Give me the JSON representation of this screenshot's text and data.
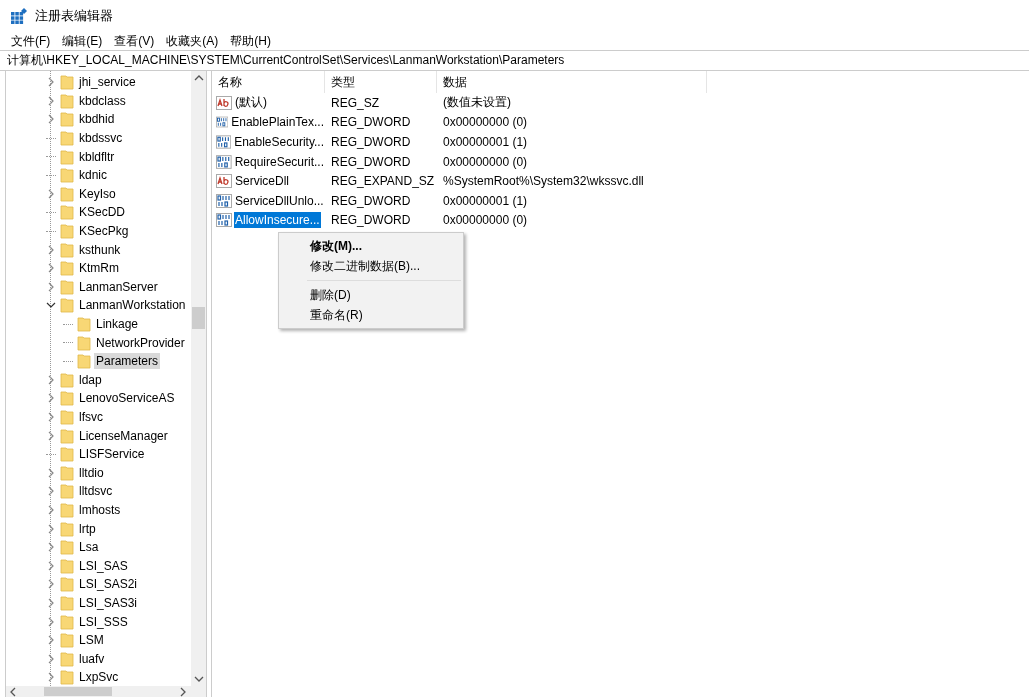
{
  "window": {
    "title": "注册表编辑器"
  },
  "menu": [
    {
      "label": "文件(F)"
    },
    {
      "label": "编辑(E)"
    },
    {
      "label": "查看(V)"
    },
    {
      "label": "收藏夹(A)"
    },
    {
      "label": "帮助(H)"
    }
  ],
  "address": "计算机\\HKEY_LOCAL_MACHINE\\SYSTEM\\CurrentControlSet\\Services\\LanmanWorkstation\\Parameters",
  "tree": [
    {
      "label": "jhi_service",
      "expandable": true,
      "expanded": false,
      "selected": false
    },
    {
      "label": "kbdclass",
      "expandable": true,
      "expanded": false,
      "selected": false
    },
    {
      "label": "kbdhid",
      "expandable": true,
      "expanded": false,
      "selected": false
    },
    {
      "label": "kbdssvc",
      "expandable": false,
      "selected": false
    },
    {
      "label": "kbldfltr",
      "expandable": false,
      "selected": false
    },
    {
      "label": "kdnic",
      "expandable": false,
      "selected": false
    },
    {
      "label": "KeyIso",
      "expandable": true,
      "expanded": false,
      "selected": false
    },
    {
      "label": "KSecDD",
      "expandable": false,
      "selected": false
    },
    {
      "label": "KSecPkg",
      "expandable": false,
      "selected": false
    },
    {
      "label": "ksthunk",
      "expandable": true,
      "expanded": false,
      "selected": false
    },
    {
      "label": "KtmRm",
      "expandable": true,
      "expanded": false,
      "selected": false
    },
    {
      "label": "LanmanServer",
      "expandable": true,
      "expanded": false,
      "selected": false
    },
    {
      "label": "LanmanWorkstation",
      "expandable": true,
      "expanded": true,
      "selected": false,
      "children": [
        {
          "label": "Linkage",
          "expandable": false,
          "selected": false
        },
        {
          "label": "NetworkProvider",
          "expandable": false,
          "selected": false
        },
        {
          "label": "Parameters",
          "expandable": false,
          "selected": true
        }
      ]
    },
    {
      "label": "ldap",
      "expandable": true,
      "expanded": false,
      "selected": false
    },
    {
      "label": "LenovoServiceAS",
      "expandable": true,
      "expanded": false,
      "selected": false
    },
    {
      "label": "lfsvc",
      "expandable": true,
      "expanded": false,
      "selected": false
    },
    {
      "label": "LicenseManager",
      "expandable": true,
      "expanded": false,
      "selected": false
    },
    {
      "label": "LISFService",
      "expandable": false,
      "selected": false
    },
    {
      "label": "lltdio",
      "expandable": true,
      "expanded": false,
      "selected": false
    },
    {
      "label": "lltdsvc",
      "expandable": true,
      "expanded": false,
      "selected": false
    },
    {
      "label": "lmhosts",
      "expandable": true,
      "expanded": false,
      "selected": false
    },
    {
      "label": "lrtp",
      "expandable": true,
      "expanded": false,
      "selected": false
    },
    {
      "label": "Lsa",
      "expandable": true,
      "expanded": false,
      "selected": false
    },
    {
      "label": "LSI_SAS",
      "expandable": true,
      "expanded": false,
      "selected": false
    },
    {
      "label": "LSI_SAS2i",
      "expandable": true,
      "expanded": false,
      "selected": false
    },
    {
      "label": "LSI_SAS3i",
      "expandable": true,
      "expanded": false,
      "selected": false
    },
    {
      "label": "LSI_SSS",
      "expandable": true,
      "expanded": false,
      "selected": false
    },
    {
      "label": "LSM",
      "expandable": true,
      "expanded": false,
      "selected": false
    },
    {
      "label": "luafv",
      "expandable": true,
      "expanded": false,
      "selected": false
    },
    {
      "label": "LxpSvc",
      "expandable": true,
      "expanded": false,
      "selected": false
    }
  ],
  "table": {
    "columns": [
      "名称",
      "类型",
      "数据"
    ],
    "rows": [
      {
        "kind": "string",
        "name": "(默认)",
        "type": "REG_SZ",
        "data": "(数值未设置)",
        "selected": false
      },
      {
        "kind": "binary",
        "name": "EnablePlainTex...",
        "type": "REG_DWORD",
        "data": "0x00000000 (0)",
        "selected": false
      },
      {
        "kind": "binary",
        "name": "EnableSecurity...",
        "type": "REG_DWORD",
        "data": "0x00000001 (1)",
        "selected": false
      },
      {
        "kind": "binary",
        "name": "RequireSecurit...",
        "type": "REG_DWORD",
        "data": "0x00000000 (0)",
        "selected": false
      },
      {
        "kind": "string",
        "name": "ServiceDll",
        "type": "REG_EXPAND_SZ",
        "data": "%SystemRoot%\\System32\\wkssvc.dll",
        "selected": false
      },
      {
        "kind": "binary",
        "name": "ServiceDllUnlo...",
        "type": "REG_DWORD",
        "data": "0x00000001 (1)",
        "selected": false
      },
      {
        "kind": "binary",
        "name": "AllowInsecure...",
        "type": "REG_DWORD",
        "data": "0x00000000 (0)",
        "selected": true
      }
    ]
  },
  "context_menu": [
    {
      "kind": "item",
      "label": "修改(M)...",
      "default": true
    },
    {
      "kind": "item",
      "label": "修改二进制数据(B)...",
      "default": false
    },
    {
      "kind": "separator"
    },
    {
      "kind": "item",
      "label": "删除(D)",
      "default": false
    },
    {
      "kind": "item",
      "label": "重命名(R)",
      "default": false
    }
  ]
}
